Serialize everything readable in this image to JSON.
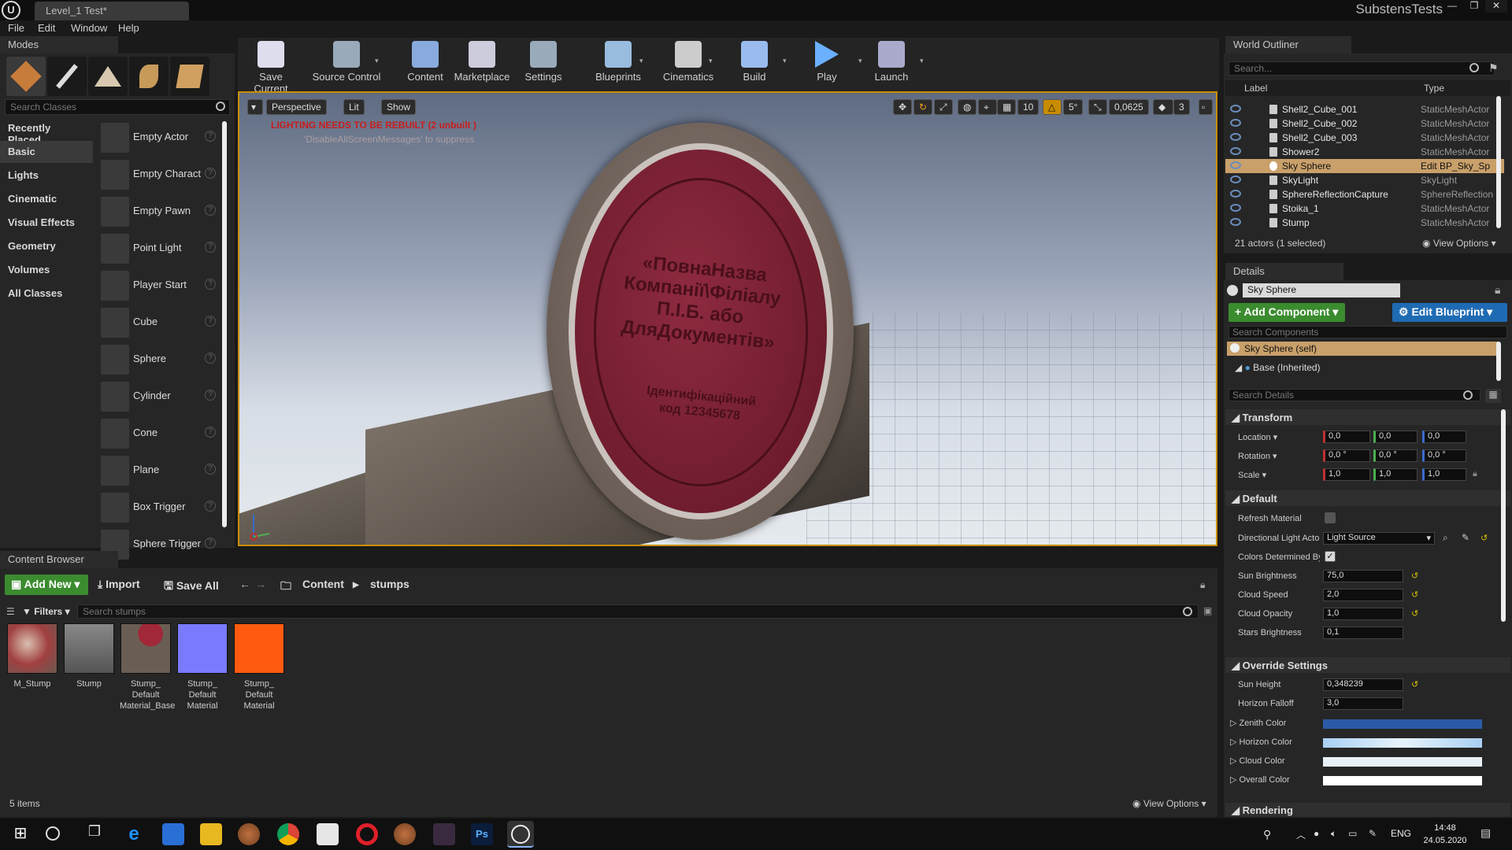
{
  "window": {
    "level_tab": "Level_1 Test*",
    "project": "SubstensTests"
  },
  "menu": [
    "File",
    "Edit",
    "Window",
    "Help"
  ],
  "modes": {
    "tab_label": "Modes",
    "search_placeholder": "Search Classes",
    "categories": [
      "Recently Placed",
      "Basic",
      "Lights",
      "Cinematic",
      "Visual Effects",
      "Geometry",
      "Volumes",
      "All Classes"
    ],
    "selected_category": "Basic",
    "actors": [
      "Empty Actor",
      "Empty Charact",
      "Empty Pawn",
      "Point Light",
      "Player Start",
      "Cube",
      "Sphere",
      "Cylinder",
      "Cone",
      "Plane",
      "Box Trigger",
      "Sphere Trigger"
    ]
  },
  "toolbar": [
    {
      "label": "Save Current",
      "icon": "save-icon"
    },
    {
      "label": "Source Control",
      "icon": "source-control-icon"
    },
    {
      "label": "Content",
      "icon": "content-icon"
    },
    {
      "label": "Marketplace",
      "icon": "marketplace-icon"
    },
    {
      "label": "Settings",
      "icon": "settings-icon"
    },
    {
      "label": "Blueprints",
      "icon": "blueprints-icon"
    },
    {
      "label": "Cinematics",
      "icon": "cinematics-icon"
    },
    {
      "label": "Build",
      "icon": "build-icon"
    },
    {
      "label": "Play",
      "icon": "play-icon"
    },
    {
      "label": "Launch",
      "icon": "launch-icon"
    }
  ],
  "viewport": {
    "perspective": "Perspective",
    "lit": "Lit",
    "show": "Show",
    "warning": "LIGHTING NEEDS TO BE REBUILT (2 unbuilt )",
    "suppress": "'DisableAllScreenMessages' to suppress",
    "grid_snap": "10",
    "rot_snap": "5°",
    "scale_snap": "0,0625",
    "cam_speed": "3",
    "seal_text": "«ПовнаНазва Компанії\\Філіалу П.І.Б. або ДляДокументів»",
    "seal_code": "Ідентифікаційний код 12345678"
  },
  "world_outliner": {
    "tab_label": "World Outliner",
    "search_placeholder": "Search...",
    "col_label": "Label",
    "col_type": "Type",
    "rows": [
      {
        "name": "Shell2_Cube_001",
        "type": "StaticMeshActor"
      },
      {
        "name": "Shell2_Cube_002",
        "type": "StaticMeshActor"
      },
      {
        "name": "Shell2_Cube_003",
        "type": "StaticMeshActor"
      },
      {
        "name": "Shower2",
        "type": "StaticMeshActor"
      },
      {
        "name": "Sky Sphere",
        "type": "Edit BP_Sky_Sp",
        "selected": true
      },
      {
        "name": "SkyLight",
        "type": "SkyLight"
      },
      {
        "name": "SphereReflectionCapture",
        "type": "SphereReflection"
      },
      {
        "name": "Stoika_1",
        "type": "StaticMeshActor"
      },
      {
        "name": "Stump",
        "type": "StaticMeshActor"
      }
    ],
    "count": "21 actors (1 selected)",
    "view_options": "View Options"
  },
  "details": {
    "tab_label": "Details",
    "object_name": "Sky Sphere",
    "add_component": "+ Add Component",
    "edit_blueprint": "Edit Blueprint",
    "search_components": "Search Components",
    "self_component": "Sky Sphere (self)",
    "base_component": "Base (Inherited)",
    "search_details": "Search Details",
    "transform": {
      "title": "Transform",
      "location_label": "Location",
      "location": [
        "0,0",
        "0,0",
        "0,0"
      ],
      "rotation_label": "Rotation",
      "rotation": [
        "0,0 °",
        "0,0 °",
        "0,0 °"
      ],
      "scale_label": "Scale",
      "scale": [
        "1,0",
        "1,0",
        "1,0"
      ]
    },
    "default": {
      "title": "Default",
      "refresh_material": "Refresh Material",
      "directional_light": "Directional Light Actor",
      "directional_light_value": "Light Source",
      "colors_determined": "Colors Determined By",
      "sun_brightness": "Sun Brightness",
      "sun_brightness_value": "75,0",
      "cloud_speed": "Cloud Speed",
      "cloud_speed_value": "2,0",
      "cloud_opacity": "Cloud Opacity",
      "cloud_opacity_value": "1,0",
      "stars_brightness": "Stars Brightness",
      "stars_brightness_value": "0,1"
    },
    "override": {
      "title": "Override Settings",
      "sun_height": "Sun Height",
      "sun_height_value": "0,348239",
      "horizon_falloff": "Horizon Falloff",
      "horizon_falloff_value": "3,0",
      "zenith_color": "Zenith Color",
      "horizon_color": "Horizon Color",
      "cloud_color": "Cloud Color",
      "overall_color": "Overall Color"
    },
    "rendering_title": "Rendering"
  },
  "content_browser": {
    "tab_label": "Content Browser",
    "add_new": "Add New",
    "import": "Import",
    "save_all": "Save All",
    "path_root": "Content",
    "path_folder": "stumps",
    "filters": "Filters",
    "search_placeholder": "Search stumps",
    "assets": [
      {
        "label": "M_Stump",
        "color": "#8a3a3a"
      },
      {
        "label": "Stump",
        "color": "#6d6d6d"
      },
      {
        "label": "Stump_ Default Material_Base",
        "color": "#7a6a60"
      },
      {
        "label": "Stump_ Default Material",
        "color": "#7a7aff"
      },
      {
        "label": "Stump_ Default Material",
        "color": "#ff5a10"
      }
    ],
    "count": "5 items",
    "view_options": "View Options"
  },
  "taskbar": {
    "lang": "ENG",
    "time": "14:48",
    "date": "24.05.2020"
  },
  "colors": {
    "accent": "#c98e00",
    "selection": "#c9a06a",
    "green_button": "#3b8b2f",
    "blue_button": "#1f6bb3",
    "zenith": "#2c5aa8",
    "horizon": "#bcdcf5",
    "cloud": "#e8f1f8",
    "overall": "#ffffff"
  }
}
